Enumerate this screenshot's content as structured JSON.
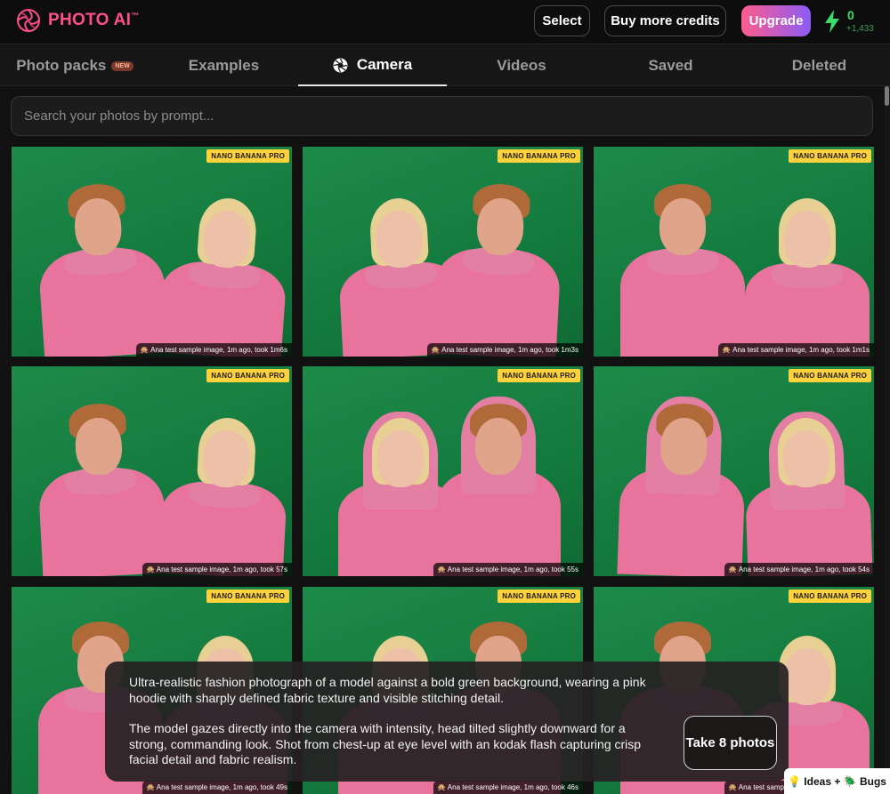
{
  "header": {
    "logo_text": "PHOTO AI",
    "logo_tm": "™",
    "select_label": "Select",
    "buy_label": "Buy more credits",
    "upgrade_label": "Upgrade",
    "credits": "0",
    "credits_delta": "+1,433",
    "bolt_icon": "lightning-bolt-icon",
    "colors": {
      "brand": "#ff4f8b",
      "credits": "#3ddc6a"
    }
  },
  "tabs": [
    {
      "label": "Photo packs",
      "badge": "NEW"
    },
    {
      "label": "Examples"
    },
    {
      "label": "Camera",
      "icon": "camera-aperture-icon",
      "active": true
    },
    {
      "label": "Videos"
    },
    {
      "label": "Saved"
    },
    {
      "label": "Deleted"
    }
  ],
  "search": {
    "placeholder": "Search your photos by prompt..."
  },
  "photos": [
    {
      "badge": "NANO BANANA PRO",
      "caption": "Ana test sample image, 1m ago, took 1m6s"
    },
    {
      "badge": "NANO BANANA PRO",
      "caption": "Ana test sample image, 1m ago, took 1m3s"
    },
    {
      "badge": "NANO BANANA PRO",
      "caption": "Ana test sample image, 1m ago, took 1m1s"
    },
    {
      "badge": "NANO BANANA PRO",
      "caption": "Ana test sample image, 1m ago, took 57s"
    },
    {
      "badge": "NANO BANANA PRO",
      "caption": "Ana test sample image, 1m ago, took 55s"
    },
    {
      "badge": "NANO BANANA PRO",
      "caption": "Ana test sample image, 1m ago, took 54s"
    },
    {
      "badge": "NANO BANANA PRO",
      "caption": "Ana test sample image, 1m ago, took 49s"
    },
    {
      "badge": "NANO BANANA PRO",
      "caption": "Ana test sample image, 1m ago, took 46s"
    },
    {
      "badge": "NANO BANANA PRO",
      "caption": "Ana test sample image, 1m ago, took 42s"
    }
  ],
  "prompt_overlay": {
    "paragraph1": "Ultra-realistic fashion photograph of a model against a bold green background, wearing a pink hoodie with sharply defined fabric texture and visible stitching detail.",
    "paragraph2": "The model gazes directly into the camera with intensity, head tilted slightly downward for a strong, commanding look. Shot from chest-up at eye level with an kodak flash capturing crisp facial detail and fabric realism.",
    "take_button": "Take 8 photos"
  },
  "feedback": {
    "label": "💡 Ideas + 🪲 Bugs"
  }
}
